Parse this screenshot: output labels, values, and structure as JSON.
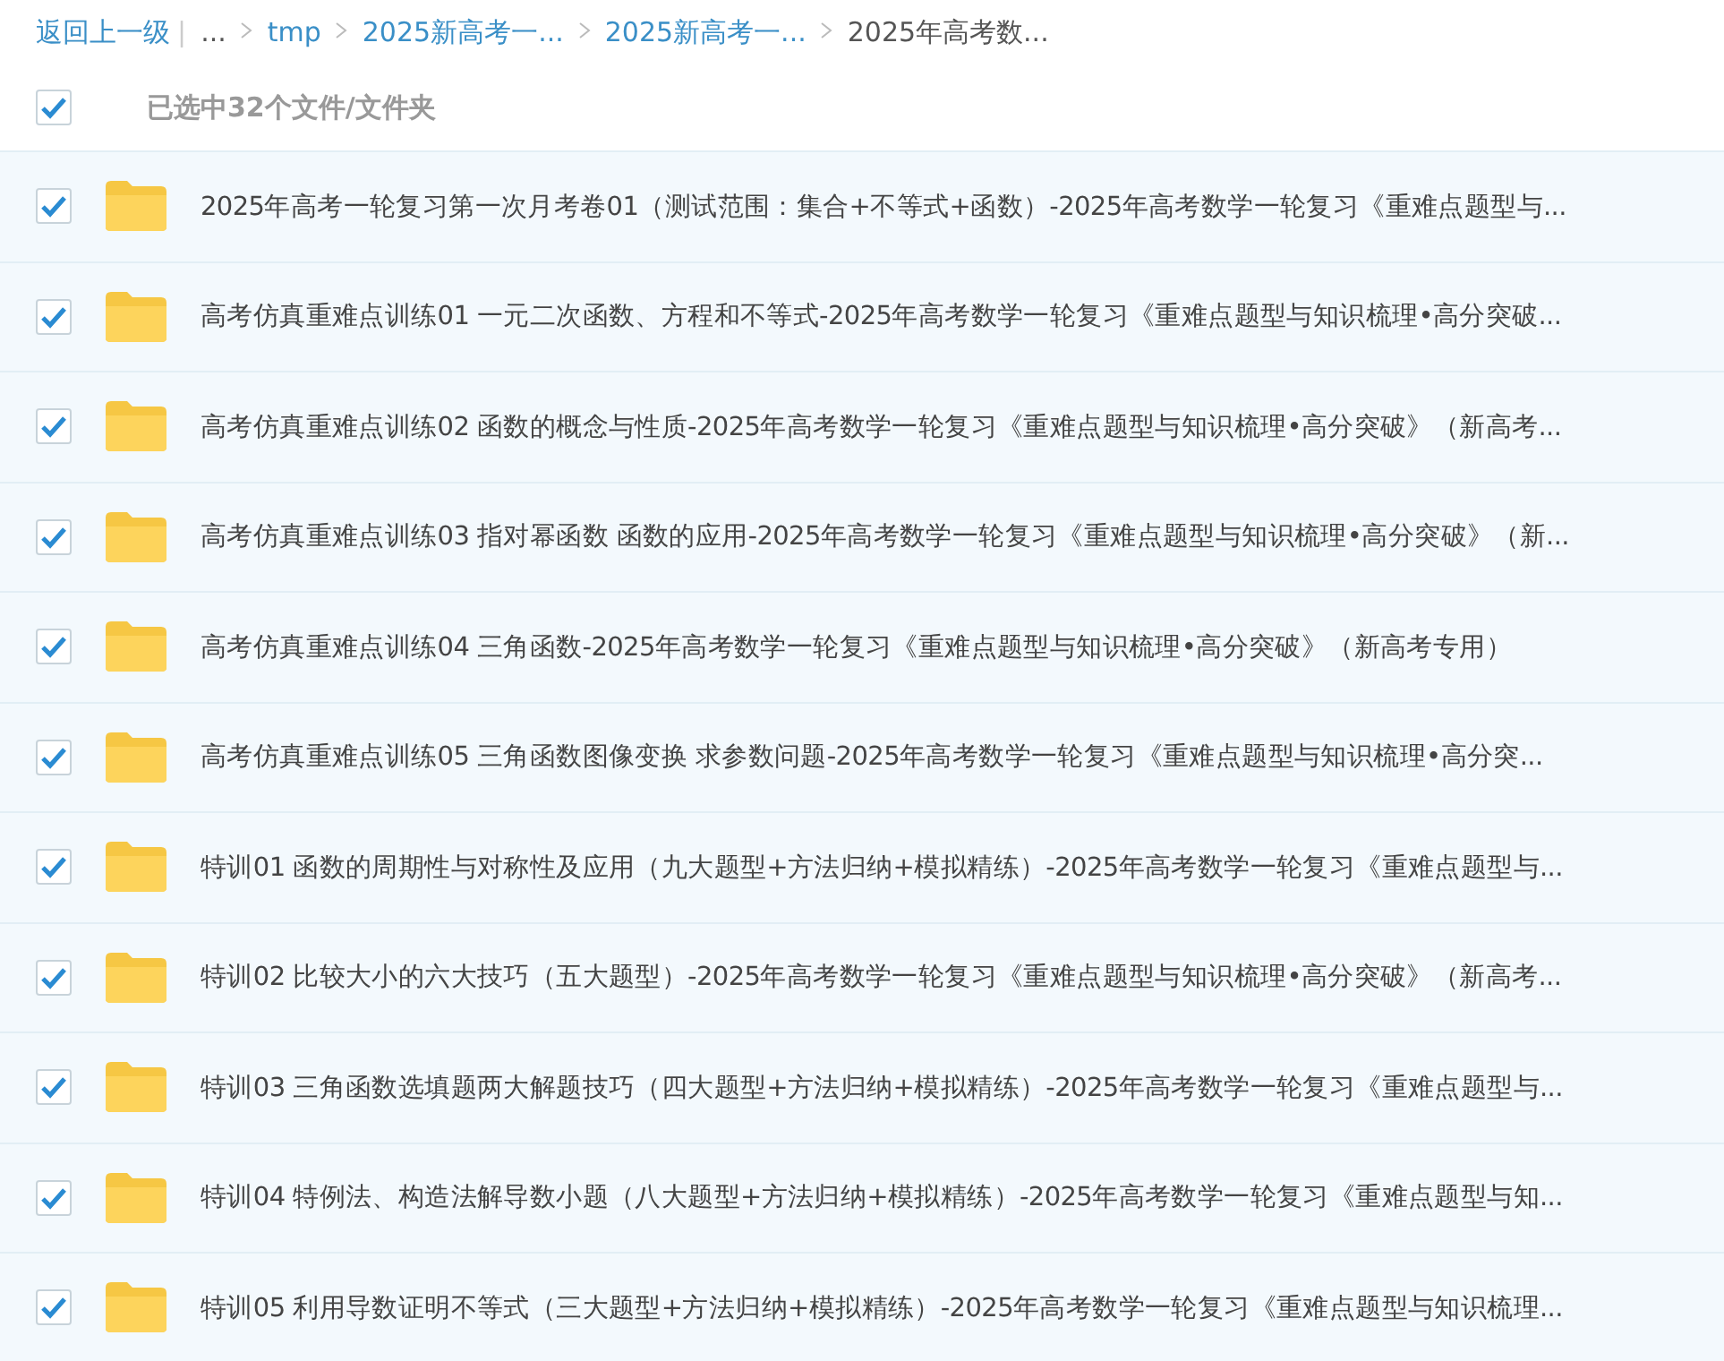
{
  "breadcrumb": {
    "back": "返回上一级",
    "separator": "|",
    "items": [
      {
        "label": "...",
        "link": false
      },
      {
        "label": "tmp",
        "link": true
      },
      {
        "label": "2025新高考一...",
        "link": true
      },
      {
        "label": "2025新高考一...",
        "link": true
      },
      {
        "label": "2025年高考数...",
        "link": false
      }
    ]
  },
  "selection": {
    "checked": true,
    "label": "已选中32个文件/文件夹"
  },
  "files": [
    {
      "checked": true,
      "name": "2025年高考一轮复习第一次月考卷01（测试范围：集合+不等式+函数）-2025年高考数学一轮复习《重难点题型与..."
    },
    {
      "checked": true,
      "name": "高考仿真重难点训练01 一元二次函数、方程和不等式-2025年高考数学一轮复习《重难点题型与知识梳理•高分突破..."
    },
    {
      "checked": true,
      "name": "高考仿真重难点训练02 函数的概念与性质-2025年高考数学一轮复习《重难点题型与知识梳理•高分突破》（新高考..."
    },
    {
      "checked": true,
      "name": "高考仿真重难点训练03 指对幂函数 函数的应用-2025年高考数学一轮复习《重难点题型与知识梳理•高分突破》（新..."
    },
    {
      "checked": true,
      "name": "高考仿真重难点训练04 三角函数-2025年高考数学一轮复习《重难点题型与知识梳理•高分突破》（新高考专用）"
    },
    {
      "checked": true,
      "name": "高考仿真重难点训练05 三角函数图像变换 求参数问题-2025年高考数学一轮复习《重难点题型与知识梳理•高分突..."
    },
    {
      "checked": true,
      "name": "特训01 函数的周期性与对称性及应用（九大题型+方法归纳+模拟精练）-2025年高考数学一轮复习《重难点题型与..."
    },
    {
      "checked": true,
      "name": "特训02 比较大小的六大技巧（五大题型）-2025年高考数学一轮复习《重难点题型与知识梳理•高分突破》（新高考..."
    },
    {
      "checked": true,
      "name": "特训03 三角函数选填题两大解题技巧（四大题型+方法归纳+模拟精练）-2025年高考数学一轮复习《重难点题型与..."
    },
    {
      "checked": true,
      "name": "特训04 特例法、构造法解导数小题（八大题型+方法归纳+模拟精练）-2025年高考数学一轮复习《重难点题型与知..."
    },
    {
      "checked": true,
      "name": "特训05 利用导数证明不等式（三大题型+方法归纳+模拟精练）-2025年高考数学一轮复习《重难点题型与知识梳理..."
    }
  ]
}
